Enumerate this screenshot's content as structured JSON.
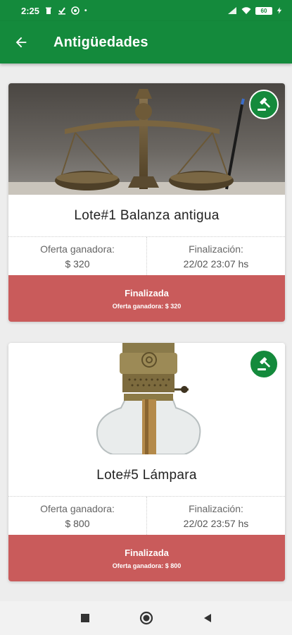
{
  "status_bar": {
    "time": "2:25",
    "battery": "60"
  },
  "app_bar": {
    "title": "Antigüedades",
    "back_icon": "arrow-left-icon"
  },
  "lots": [
    {
      "title": "Lote#1 Balanza antigua",
      "image_subject": "antique brass balance scale",
      "winning_bid_label": "Oferta ganadora:",
      "winning_bid_value": "$ 320",
      "end_label": "Finalización:",
      "end_value": "22/02 23:07 hs",
      "status": "Finalizada",
      "status_detail": "Oferta ganadora: $ 320",
      "badge_icon": "gavel-icon"
    },
    {
      "title": "Lote#5 Lámpara",
      "image_subject": "antique oil lamp",
      "winning_bid_label": "Oferta ganadora:",
      "winning_bid_value": "$ 800",
      "end_label": "Finalización:",
      "end_value": "22/02 23:57 hs",
      "status": "Finalizada",
      "status_detail": "Oferta ganadora: $ 800",
      "badge_icon": "gavel-icon"
    }
  ],
  "colors": {
    "primary": "#148a3c",
    "finished": "#c95b5b",
    "background": "#ededed"
  },
  "nav": [
    "recents-square-icon",
    "home-circle-icon",
    "back-triangle-icon"
  ]
}
